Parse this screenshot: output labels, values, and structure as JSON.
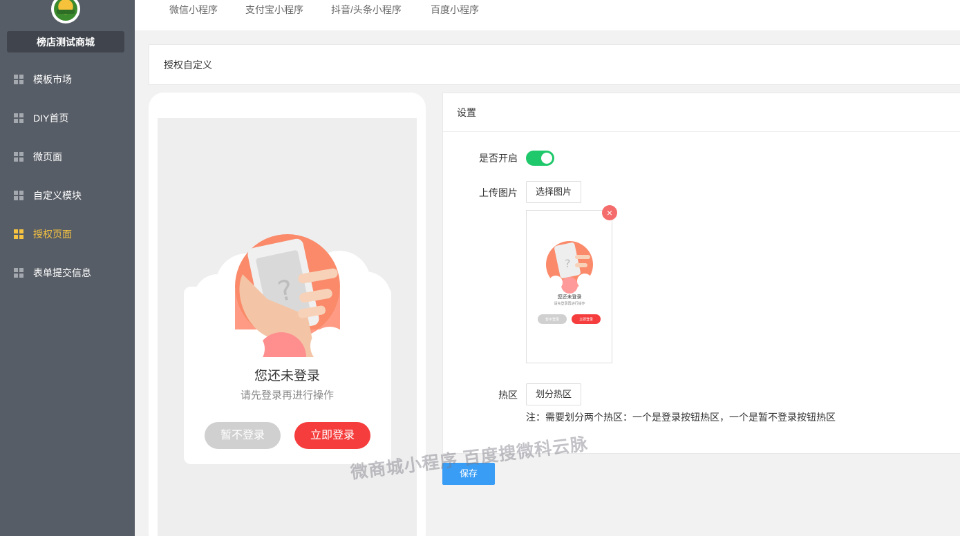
{
  "sidebar": {
    "shop_name": "榜店测试商城",
    "items": [
      {
        "label": "模板市场",
        "active": false
      },
      {
        "label": "DIY首页",
        "active": false
      },
      {
        "label": "微页面",
        "active": false
      },
      {
        "label": "自定义模块",
        "active": false
      },
      {
        "label": "授权页面",
        "active": true
      },
      {
        "label": "表单提交信息",
        "active": false
      }
    ]
  },
  "tabs": [
    "微信小程序",
    "支付宝小程序",
    "抖音/头条小程序",
    "百度小程序"
  ],
  "page_title": "授权自定义",
  "preview": {
    "title": "您还未登录",
    "subtitle": "请先登录再进行操作",
    "skip_label": "暂不登录",
    "login_label": "立即登录"
  },
  "settings": {
    "header": "设置",
    "enable_label": "是否开启",
    "enabled": true,
    "upload_label": "上传图片",
    "choose_image_label": "选择图片",
    "thumb_title": "您还未登录",
    "thumb_subtitle": "请先登录再进行操作",
    "thumb_skip": "暂不登录",
    "thumb_login": "立即登录",
    "delete_glyph": "×",
    "hotspot_label": "热区",
    "hotspot_button": "划分热区",
    "note": "注：需要划分两个热区：一个是登录按钮热区，一个是暂不登录按钮热区"
  },
  "save_label": "保存",
  "watermark": "微商城小程序 百度搜微科云脉",
  "colors": {
    "sidebar_bg": "#575d66",
    "active": "#f5c242",
    "switch_on": "#1fc86a",
    "primary": "#3a9df5",
    "login_red": "#f53d3d",
    "delete_red": "#f56c6c"
  }
}
